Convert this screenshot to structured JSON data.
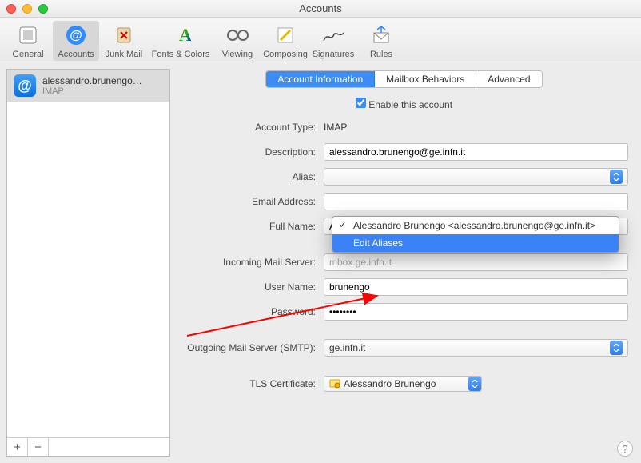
{
  "window": {
    "title": "Accounts"
  },
  "toolbar": {
    "general": "General",
    "accounts": "Accounts",
    "junk": "Junk Mail",
    "fonts": "Fonts & Colors",
    "viewing": "Viewing",
    "composing": "Composing",
    "signatures": "Signatures",
    "rules": "Rules"
  },
  "sidebar": {
    "account_name": "alessandro.brunengo…",
    "account_type": "IMAP"
  },
  "tabs": {
    "info": "Account Information",
    "mailbox": "Mailbox Behaviors",
    "advanced": "Advanced"
  },
  "enable_label": "Enable this account",
  "labels": {
    "account_type": "Account Type:",
    "description": "Description:",
    "alias": "Alias:",
    "email": "Email Address:",
    "fullname": "Full Name:",
    "incoming": "Incoming Mail Server:",
    "username": "User Name:",
    "password": "Password:",
    "outgoing": "Outgoing Mail Server (SMTP):",
    "tls": "TLS Certificate:"
  },
  "values": {
    "account_type": "IMAP",
    "description": "alessandro.brunengo@ge.infn.it",
    "fullname": "Alessandro Brunengo",
    "incoming": "mbox.ge.infn.it",
    "username": "brunengo",
    "password": "••••••••",
    "outgoing": "ge.infn.it",
    "tls": "Alessandro Brunengo"
  },
  "alias_menu": {
    "selected": "Alessandro Brunengo <alessandro.brunengo@ge.infn.it>",
    "edit": "Edit Aliases"
  }
}
